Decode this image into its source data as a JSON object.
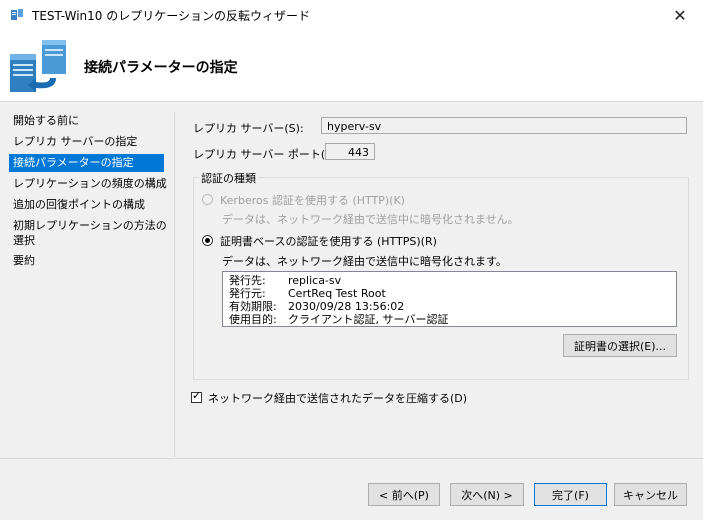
{
  "window": {
    "title": "TEST-Win10 のレプリケーションの反転ウィザード",
    "close_glyph": "✕"
  },
  "header": {
    "title": "接続パラメーターの指定"
  },
  "nav": {
    "items": [
      {
        "label": "開始する前に",
        "selected": false
      },
      {
        "label": "レプリカ サーバーの指定",
        "selected": false
      },
      {
        "label": "接続パラメーターの指定",
        "selected": true
      },
      {
        "label": "レプリケーションの頻度の構成",
        "selected": false
      },
      {
        "label": "追加の回復ポイントの構成",
        "selected": false
      },
      {
        "label": "初期レプリケーションの方法の選択",
        "selected": false
      },
      {
        "label": "要約",
        "selected": false
      }
    ]
  },
  "form": {
    "replica_server_label": "レプリカ サーバー(S):",
    "replica_server_value": "hyperv-sv",
    "replica_port_label": "レプリカ サーバー ポート(O):",
    "replica_port_value": "443",
    "auth_group_label": "認証の種類",
    "kerberos_label": "Kerberos 認証を使用する (HTTP)(K)",
    "kerberos_desc": "データは、ネットワーク経由で送信中に暗号化されません。",
    "cert_label": "証明書ベースの認証を使用する (HTTPS)(R)",
    "cert_desc": "データは、ネットワーク経由で送信中に暗号化されます。",
    "cert_info": {
      "issued_to_key": "発行先:",
      "issued_to_val": "replica-sv",
      "issued_by_key": "発行元:",
      "issued_by_val": "CertReq Test Root",
      "expiry_key": "有効期限:",
      "expiry_val": "2030/09/28 13:56:02",
      "purpose_key": "使用目的:",
      "purpose_val": "クライアント認証, サーバー認証"
    },
    "select_cert_button": "証明書の選択(E)...",
    "compress_label": "ネットワーク経由で送信されたデータを圧縮する(D)",
    "compress_checked": true
  },
  "footer": {
    "back": "< 前へ(P)",
    "next": "次へ(N) >",
    "finish": "完了(F)",
    "cancel": "キャンセル"
  },
  "colors": {
    "accent": "#0078d7",
    "window_bg": "#f0f0f0"
  },
  "icons": {
    "title": "replication-icon",
    "header": "server-replication-icon"
  }
}
